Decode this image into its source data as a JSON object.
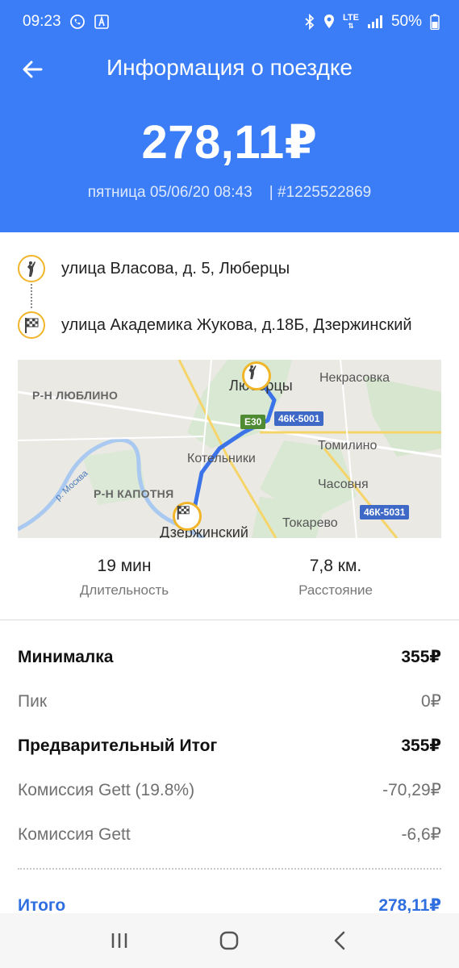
{
  "status_bar": {
    "time": "09:23",
    "network": "LTE",
    "battery": "50%",
    "icons": [
      "phone-icon",
      "app-icon",
      "bluetooth-icon",
      "location-icon",
      "lte-icon",
      "signal-icon",
      "battery-icon"
    ]
  },
  "header": {
    "title": "Информация о поездке",
    "total": "278,11₽",
    "date": "пятница 05/06/20 08:43",
    "order_id": "| #1225522869",
    "background": "#3b7df6"
  },
  "route": {
    "pickup": "улица Власова, д. 5, Люберцы",
    "dropoff": "улица Академика Жукова, д.18Б, Дзержинский"
  },
  "map": {
    "labels": {
      "lyublino": "Р-Н ЛЮБЛИНО",
      "kapotnya": "Р-Н КАПОТНЯ",
      "lyubertsy": "Люберцы",
      "nekrasovka": "Некрасовка",
      "tomilino": "Томилино",
      "kotelniki": "Котельники",
      "chasovnya": "Часовня",
      "tokarevo": "Токарево",
      "dzerzhinsky": "Дзержинский",
      "river": "р. Москва"
    },
    "roads": {
      "e30": "E30",
      "r1": "46К-5001",
      "r2": "46К-5031"
    }
  },
  "stats": {
    "duration_value": "19 мин",
    "duration_label": "Длительность",
    "distance_value": "7,8 км.",
    "distance_label": "Расстояние"
  },
  "fare": {
    "rows": [
      {
        "label": "Минималка",
        "value": "355₽"
      },
      {
        "label": "Пик",
        "value": "0₽"
      },
      {
        "label": "Предварительный Итог",
        "value": "355₽"
      },
      {
        "label": "Комиссия Gett (19.8%)",
        "value": "-70,29₽"
      },
      {
        "label": "Комиссия Gett",
        "value": "-6,6₽"
      }
    ],
    "total_label": "Итого",
    "total_value": "278,11₽",
    "accent": "#2f6fe0"
  },
  "nav": {
    "icons": [
      "recent-apps-icon",
      "home-icon",
      "back-icon"
    ]
  }
}
